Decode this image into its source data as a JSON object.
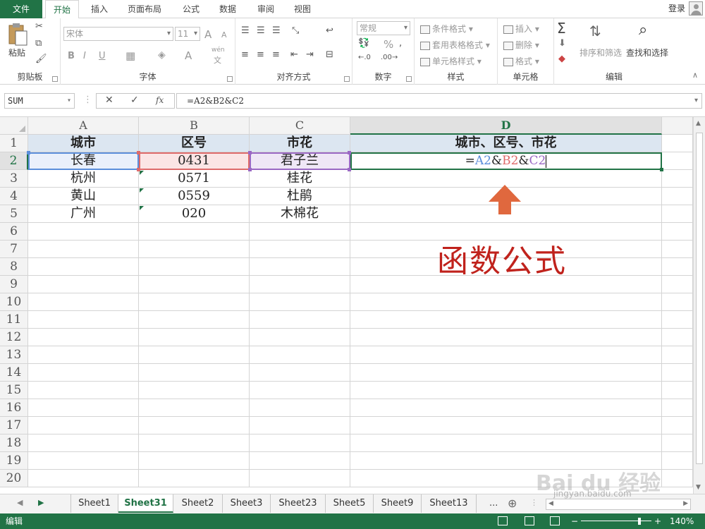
{
  "ribbon_tabs": [
    {
      "label": "文件"
    },
    {
      "label": "开始"
    },
    {
      "label": "插入"
    },
    {
      "label": "页面布局"
    },
    {
      "label": "公式"
    },
    {
      "label": "数据"
    },
    {
      "label": "审阅"
    },
    {
      "label": "视图"
    }
  ],
  "login_label": "登录",
  "clipboard": {
    "paste": "粘贴",
    "label": "剪贴板"
  },
  "font": {
    "name": "宋体",
    "size": "11",
    "bold": "B",
    "italic": "I",
    "underline": "U",
    "grow": "A",
    "shrink": "A",
    "color": "A",
    "phonetic_top": "wén",
    "phonetic_bottom": "文",
    "label": "字体"
  },
  "alignment": {
    "label": "对齐方式"
  },
  "number": {
    "format": "常规",
    "percent": "%",
    "label": "数字"
  },
  "styles": {
    "conditional": "条件格式",
    "table": "套用表格格式",
    "cell": "单元格样式",
    "label": "样式"
  },
  "cells": {
    "insert": "插入",
    "delete": "删除",
    "format": "格式",
    "label": "单元格"
  },
  "editing": {
    "sort": "排序和筛选",
    "find": "查找和选择",
    "label": "编辑"
  },
  "formula_bar": {
    "name_box": "SUM",
    "cancel": "✕",
    "enter": "✓",
    "fx": "fx",
    "formula": "=A2&B2&C2"
  },
  "columns": [
    "A",
    "B",
    "C",
    "D"
  ],
  "rows": [
    "1",
    "2",
    "3",
    "4",
    "5",
    "6",
    "7",
    "8",
    "9",
    "10",
    "11",
    "12",
    "13",
    "14",
    "15",
    "16",
    "17",
    "18",
    "19",
    "20"
  ],
  "cells_data": {
    "r1": {
      "a": "城市",
      "b": "区号",
      "c": "市花",
      "d": "城市、区号、市花"
    },
    "r2": {
      "a": "长春",
      "b": "0431",
      "c": "君子兰"
    },
    "r3": {
      "a": "杭州",
      "b": "0571",
      "c": "桂花"
    },
    "r4": {
      "a": "黄山",
      "b": "0559",
      "c": "杜鹃"
    },
    "r5": {
      "a": "广州",
      "b": "020",
      "c": "木棉花"
    }
  },
  "editing_cell": {
    "eq": "=",
    "ref1": "A2",
    "amp1": "&",
    "ref2": "B2",
    "amp2": "&",
    "ref3": "C2"
  },
  "ref_colors": {
    "A2": "#5b8edb",
    "B2": "#de6a6a",
    "C2": "#9a68c4"
  },
  "annotation": "函数公式",
  "sheet_tabs": [
    {
      "label": "Sheet1"
    },
    {
      "label": "Sheet31"
    },
    {
      "label": "Sheet2"
    },
    {
      "label": "Sheet3"
    },
    {
      "label": "Sheet23"
    },
    {
      "label": "Sheet5"
    },
    {
      "label": "Sheet9"
    },
    {
      "label": "Sheet13"
    }
  ],
  "sheet_more": "...",
  "status": {
    "mode": "编辑",
    "zoom": "140%"
  },
  "watermark": {
    "brand": "Bai du 经验",
    "url": "jingyan.baidu.com"
  },
  "colors": {
    "accent": "#217346",
    "header_fill": "#dce6f1",
    "annotation": "#c0221c"
  }
}
